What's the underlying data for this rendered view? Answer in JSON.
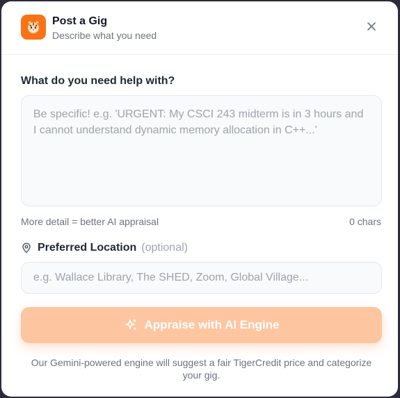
{
  "header": {
    "title": "Post a Gig",
    "subtitle": "Describe what you need",
    "logo_icon": "tiger-icon",
    "close_icon": "close-icon"
  },
  "description": {
    "label": "What do you need help with?",
    "placeholder": "Be specific! e.g. 'URGENT: My CSCI 243 midterm is in 3 hours and I cannot understand dynamic memory allocation in C++...'",
    "value": "",
    "hint": "More detail = better AI appraisal",
    "char_count": "0 chars"
  },
  "location": {
    "icon": "map-pin-icon",
    "label": "Preferred Location",
    "optional": "(optional)",
    "placeholder": "e.g. Wallace Library, The SHED, Zoom, Global Village...",
    "value": ""
  },
  "appraise_button": {
    "icon": "sparkles-icon",
    "label": "Appraise with AI Engine",
    "disabled": true
  },
  "footer": {
    "text": "Our Gemini-powered engine will suggest a fair TigerCredit price and categorize your gig."
  },
  "colors": {
    "accent": "#f97316",
    "button_disabled": "#fdc6a0",
    "text_primary": "#111827",
    "text_muted": "#6b7280",
    "placeholder": "#9ca3af"
  }
}
